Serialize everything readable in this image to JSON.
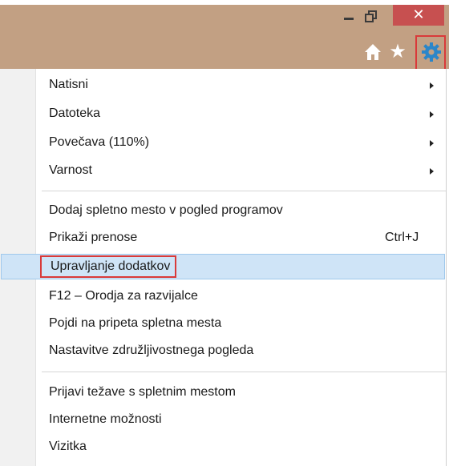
{
  "window": {
    "close_glyph": "✕",
    "star_glyph": "★"
  },
  "icons": {
    "home": "home-icon",
    "favorites": "star-icon",
    "tools": "gear-icon",
    "minimize": "minimize-icon",
    "restore": "restore-icon",
    "close": "close-icon",
    "submenu": "chevron-right-icon"
  },
  "colors": {
    "titlebar": "#c2a083",
    "close_button": "#c75050",
    "gear": "#2b86c9",
    "highlight": "#cfe4f7",
    "callout": "#d93a3a"
  },
  "menu": {
    "groups": [
      [
        {
          "label": "Natisni",
          "submenu": true
        },
        {
          "label": "Datoteka",
          "submenu": true
        },
        {
          "label": "Povečava (110%)",
          "submenu": true
        },
        {
          "label": "Varnost",
          "submenu": true
        }
      ],
      [
        {
          "label": "Dodaj spletno mesto v pogled programov"
        },
        {
          "label": "Prikaži prenose",
          "shortcut": "Ctrl+J"
        },
        {
          "label": "Upravljanje dodatkov",
          "highlighted": true
        },
        {
          "label": "F12 – Orodja za razvijalce"
        },
        {
          "label": "Pojdi na pripeta spletna mesta"
        },
        {
          "label": "Nastavitve združljivostnega pogleda"
        }
      ],
      [
        {
          "label": "Prijavi težave s spletnim mestom"
        },
        {
          "label": "Internetne možnosti"
        },
        {
          "label": "Vizitka"
        }
      ]
    ]
  }
}
